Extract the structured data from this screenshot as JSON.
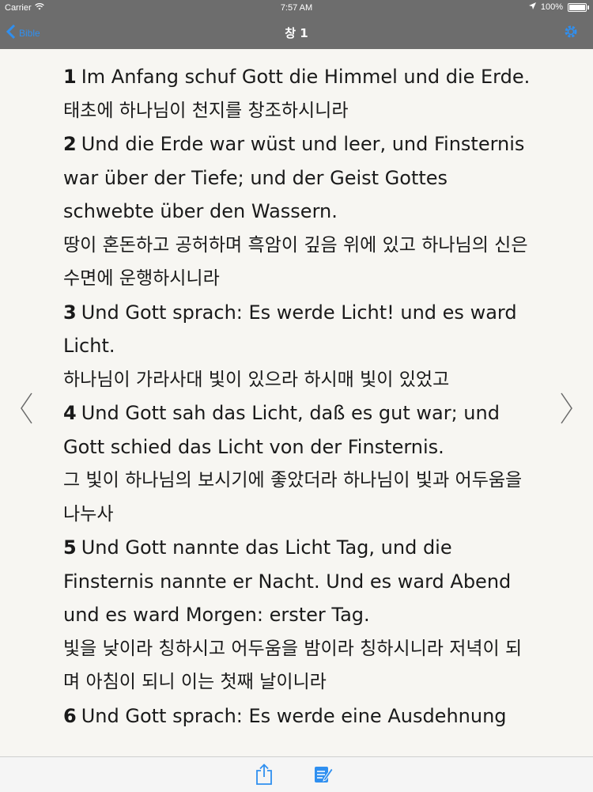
{
  "status_bar": {
    "carrier": "Carrier",
    "time": "7:57 AM",
    "battery": "100%",
    "battery_level": 1.0
  },
  "nav": {
    "back_label": "Bible",
    "title": "창 1"
  },
  "verses": [
    {
      "num": "1",
      "de": "Im Anfang schuf Gott die Himmel und die Erde.",
      "ko": "태초에 하나님이 천지를 창조하시니라"
    },
    {
      "num": "2",
      "de": "Und die Erde war wüst und leer, und Finsternis war über der Tiefe; und der Geist Gottes schwebte über den Wassern.",
      "ko": "땅이 혼돈하고 공허하며 흑암이 깊음 위에 있고 하나님의 신은 수면에 운행하시니라"
    },
    {
      "num": "3",
      "de": "Und Gott sprach: Es werde Licht! und es ward Licht.",
      "ko": "하나님이 가라사대 빛이 있으라 하시매 빛이 있었고"
    },
    {
      "num": "4",
      "de": "Und Gott sah das Licht, daß es gut war; und Gott schied das Licht von der Finsternis.",
      "ko": "그 빛이 하나님의 보시기에 좋았더라 하나님이 빛과 어두움을 나누사"
    },
    {
      "num": "5",
      "de": "Und Gott nannte das Licht Tag, und die Finsternis nannte er Nacht. Und es ward Abend und es ward Morgen: erster Tag.",
      "ko": "빛을 낮이라 칭하시고 어두움을 밤이라 칭하시니라 저녁이 되며 아침이 되니 이는 첫째 날이니라"
    },
    {
      "num": "6",
      "de": "Und Gott sprach: Es werde eine Ausdehnung",
      "ko": ""
    }
  ],
  "colors": {
    "bar": "#6d6d6d",
    "accent": "#2f8ff0",
    "background": "#f7f6f2"
  },
  "icons": [
    "wifi-icon",
    "location-arrow-icon",
    "battery-icon",
    "chevron-left-icon",
    "gear-icon",
    "prev-chapter-icon",
    "next-chapter-icon",
    "share-icon",
    "edit-note-icon"
  ]
}
